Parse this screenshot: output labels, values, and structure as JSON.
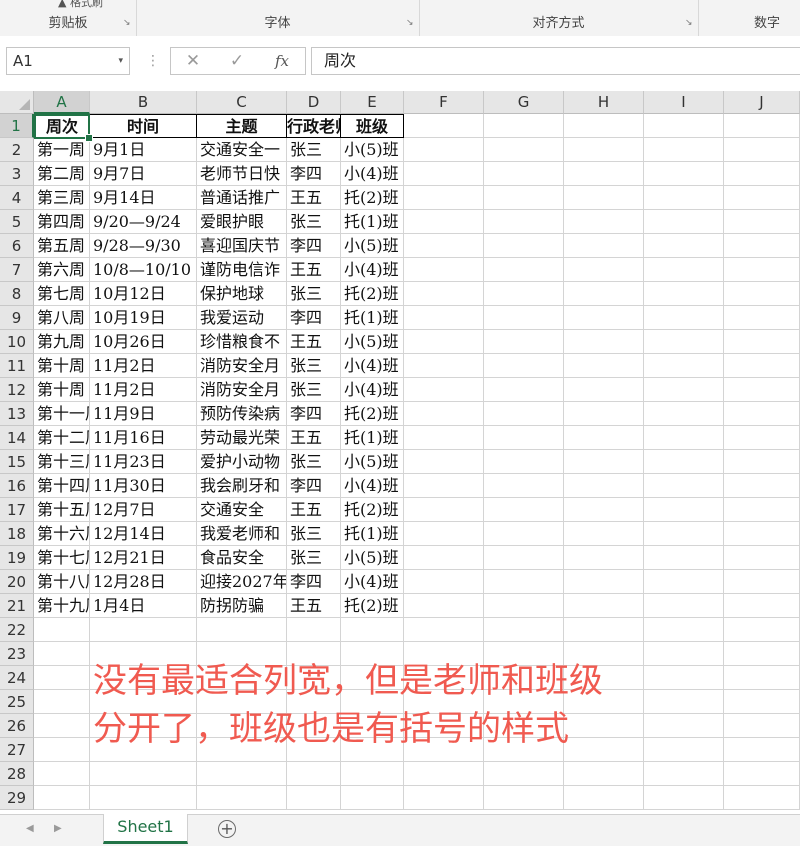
{
  "ribbon": {
    "top_fragment": "▲ 格式刷",
    "groups": [
      {
        "label": "剪贴板",
        "launcher": "↘"
      },
      {
        "label": "字体",
        "launcher": "↘"
      },
      {
        "label": "对齐方式",
        "launcher": "↘"
      },
      {
        "label": "数字",
        "launcher": ""
      }
    ]
  },
  "formula_bar": {
    "name_box": "A1",
    "name_box_arrow": "▾",
    "dots": "⋮",
    "cancel": "✕",
    "enter": "✓",
    "fx": "fx",
    "value": "周次"
  },
  "columns": [
    "A",
    "B",
    "C",
    "D",
    "E",
    "F",
    "G",
    "H",
    "I",
    "J"
  ],
  "rows": [
    "1",
    "2",
    "3",
    "4",
    "5",
    "6",
    "7",
    "8",
    "9",
    "10",
    "11",
    "12",
    "13",
    "14",
    "15",
    "16",
    "17",
    "18",
    "19",
    "20",
    "21",
    "22",
    "23",
    "24",
    "25",
    "26",
    "27",
    "28",
    "29"
  ],
  "headers": [
    "周次",
    "时间",
    "主题",
    "行政老师",
    "班级"
  ],
  "table": [
    [
      "第一周",
      "9月1日",
      "交通安全一",
      "张三",
      "小(5)班"
    ],
    [
      "第二周",
      "9月7日",
      "老师节日快",
      "李四",
      "小(4)班"
    ],
    [
      "第三周",
      "9月14日",
      "普通话推广",
      "王五",
      "托(2)班"
    ],
    [
      "第四周",
      "9/20—9/24",
      "爱眼护眼",
      "张三",
      "托(1)班"
    ],
    [
      "第五周",
      "9/28—9/30",
      "喜迎国庆节",
      "李四",
      "小(5)班"
    ],
    [
      "第六周",
      "10/8—10/10",
      "谨防电信诈",
      "王五",
      "小(4)班"
    ],
    [
      "第七周",
      "10月12日",
      "保护地球",
      "张三",
      "托(2)班"
    ],
    [
      "第八周",
      "10月19日",
      "我爱运动",
      "李四",
      "托(1)班"
    ],
    [
      "第九周",
      "10月26日",
      "珍惜粮食不",
      "王五",
      "小(5)班"
    ],
    [
      "第十周",
      "11月2日",
      "消防安全月",
      "张三",
      "小(4)班"
    ],
    [
      "第十周",
      "11月2日",
      "消防安全月",
      "张三",
      "小(4)班"
    ],
    [
      "第十一周",
      "11月9日",
      "预防传染病",
      "李四",
      "托(2)班"
    ],
    [
      "第十二周",
      "11月16日",
      "劳动最光荣",
      "王五",
      "托(1)班"
    ],
    [
      "第十三周",
      "11月23日",
      "爱护小动物",
      "张三",
      "小(5)班"
    ],
    [
      "第十四周",
      "11月30日",
      "我会刷牙和",
      "李四",
      "小(4)班"
    ],
    [
      "第十五周",
      "12月7日",
      "交通安全",
      "王五",
      "托(2)班"
    ],
    [
      "第十六周",
      "12月14日",
      "我爱老师和",
      "张三",
      "托(1)班"
    ],
    [
      "第十七周",
      "12月21日",
      "食品安全",
      "张三",
      "小(5)班"
    ],
    [
      "第十八周",
      "12月28日",
      "迎接2027年",
      "李四",
      "小(4)班"
    ],
    [
      "第十九周",
      "1月4日",
      "防拐防骗",
      "王五",
      "托(2)班"
    ]
  ],
  "annotation": {
    "line1": "没有最适合列宽，但是老师和班级",
    "line2": "分开了，班级也是有括号的样式",
    "color": "#f05a50"
  },
  "sheet_tabs": {
    "prev": "◀",
    "next": "▶",
    "active": "Sheet1",
    "add": "+"
  },
  "colors": {
    "accent": "#217346"
  }
}
